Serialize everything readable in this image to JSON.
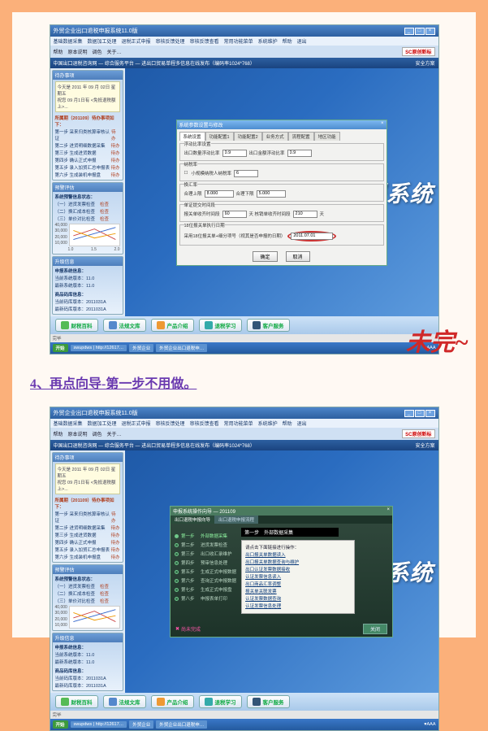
{
  "step_text": "4、再点向导-第一步不用做。",
  "unfinished_text": "未完~",
  "app": {
    "title": "外贸企业出口退税申报系统11.0版",
    "window_buttons": {
      "min": "_",
      "max": "□",
      "close": "×"
    }
  },
  "menubar": [
    "基础数据采集",
    "数据加工处理",
    "退税正式申报",
    "审核反馈处理",
    "审核反馈查看",
    "常用功能菜单",
    "系统维护",
    "帮助",
    "退出"
  ],
  "toolbar": {
    "items": [
      "帮助",
      "原本说明",
      "调色",
      "关于…"
    ],
    "sc_label": "SC原创新标"
  },
  "bluebar": {
    "left": "中国出口退税咨询网 — 综合服务平台 — 进出口贸易单程多信息在线发布（编码率1024*768）",
    "right": "安全方案"
  },
  "sidebar": {
    "todo_title": "待办事项",
    "note": {
      "line1": "今天是 2011 年 09 月 02日 星期五",
      "line2": "祝您 09 月1日有 <免抵退税额上>..."
    },
    "period_header": "所属期（201109）待办事项如下：",
    "todo_items": [
      {
        "label": "第一步 采来归类核算审核认证",
        "act": "待办"
      },
      {
        "label": "第二步 进货明细数据采集",
        "act": "待办"
      },
      {
        "label": "第三步 生成进货数据",
        "act": "待办"
      },
      {
        "label": "第四步 确认正式申报",
        "act": "待办"
      },
      {
        "label": "第五步 录入加贸汇总申报表",
        "act": "待办"
      },
      {
        "label": "第六步 生成装机申报盘",
        "act": "待办"
      }
    ],
    "forecast_title": "预警评估",
    "forecast_sub": "系统预警信息状态：",
    "forecast_items": [
      {
        "label": "（一）进货发票检查",
        "act": "检查"
      },
      {
        "label": "（二）换汇成本检查",
        "act": "检查"
      },
      {
        "label": "（三）单价对比检查",
        "act": "检查"
      }
    ],
    "chart_legend": [
      "40,000",
      "30,000",
      "20,000",
      "10,000"
    ],
    "chart_x": [
      "1.0",
      "1.5",
      "2.0"
    ],
    "upgrade_title": "升级信息",
    "upgrade_sub": "申报系统信息：",
    "upgrade_items": [
      "当前系统版本：11.0",
      "最新系统版本：11.0"
    ],
    "code_title": "商品码库信息：",
    "code_items": [
      "当前码库版本：2011031A",
      "最新码库版本：2011031A"
    ]
  },
  "main_bg_text": "报系统",
  "dialog1": {
    "title": "系统参数设置与修改",
    "close": "×",
    "tabs": [
      "系统设置",
      "功能配置1",
      "功能配置2",
      "业务方式",
      "流程配置",
      "地区功能"
    ],
    "active_tab": 0,
    "group_fudong": "浮动比率设置",
    "fudong_labels": {
      "a": "出口数量浮动比率",
      "b": "出口金额浮动比率"
    },
    "fudong_values": {
      "a": "0.9",
      "b": "0.9"
    },
    "group_nashui": "纳税率",
    "nashui_label": "小规模纳税人纳税率",
    "nashui_value": "6",
    "group_huilv": "换汇率",
    "hl_labels": {
      "a": "合理上限",
      "b": "合理下限"
    },
    "hl_values": {
      "a": "8.000",
      "b": "5.000"
    },
    "group_shijian": "单证提交时间段",
    "sj_labels": {
      "a": "报关单收齐时间段",
      "b": "天 核销单收齐时间段",
      "c": "天"
    },
    "sj_values": {
      "a": "60",
      "b": "210"
    },
    "group_18": "18位报关单执行日期",
    "tip_18": "采用18位报关单+细分项号（视其是否申报的日期）",
    "date_18": "2011.07.01",
    "btns": {
      "ok": "确定",
      "cancel": "取消"
    }
  },
  "bottom_buttons": [
    {
      "label": "财税百科",
      "ico": "ico-green"
    },
    {
      "label": "法规文库",
      "ico": "ico-blue"
    },
    {
      "label": "产品介绍",
      "ico": "ico-orange"
    },
    {
      "label": "退税学习",
      "ico": "ico-teal"
    },
    {
      "label": "客户服务",
      "ico": "ico-navy"
    }
  ],
  "statusbar": "完毕",
  "taskbar": {
    "start": "开始",
    "tasks": [
      "swupdws | http://12617…",
      "外贸企业",
      "外贸企业出口退税申…"
    ],
    "tray": "♥AAA"
  },
  "wizard": {
    "title": "申报系统操作向导 — 201109",
    "tabs": [
      "出口退税申报向导",
      "出口退税申报流程"
    ],
    "active": 0,
    "steps": [
      {
        "label": "第一步",
        "name": "外部数据采集",
        "cur": true
      },
      {
        "label": "第二步",
        "name": "进货发票检查"
      },
      {
        "label": "第三步",
        "name": "出口收汇录维护"
      },
      {
        "label": "第四步",
        "name": "预审信息处理"
      },
      {
        "label": "第五步",
        "name": "生成正式申报数据"
      },
      {
        "label": "第六步",
        "name": "查询正式申报数据"
      },
      {
        "label": "第七步",
        "name": "生成正式申报盘"
      },
      {
        "label": "第八步",
        "name": "申报表单打印"
      }
    ],
    "desc_title": "第一步　外部数据采集",
    "desc_intro": "请点击下面链接进行操作：",
    "desc_links": [
      "出口报关单数据读入",
      "出口报关单数据查询与维护",
      "出口认证发票数据接收",
      "认证发票信息读入",
      "出口商品汇率调整",
      "报关单关联发票",
      "认证发票数据查询",
      "认证发票信息处理"
    ],
    "foot_status": "尚未完成",
    "close": "关闭"
  },
  "chart_data": {
    "type": "line",
    "title": "",
    "xlabel": "",
    "ylabel": "",
    "x": [
      1.0,
      1.5,
      2.0
    ],
    "series": [
      {
        "name": "red",
        "values": [
          22000,
          33000,
          18000
        ]
      },
      {
        "name": "blue",
        "values": [
          15000,
          26000,
          30000
        ]
      },
      {
        "name": "orange",
        "values": [
          28000,
          20000,
          25000
        ]
      }
    ],
    "ylim": [
      10000,
      40000
    ]
  }
}
